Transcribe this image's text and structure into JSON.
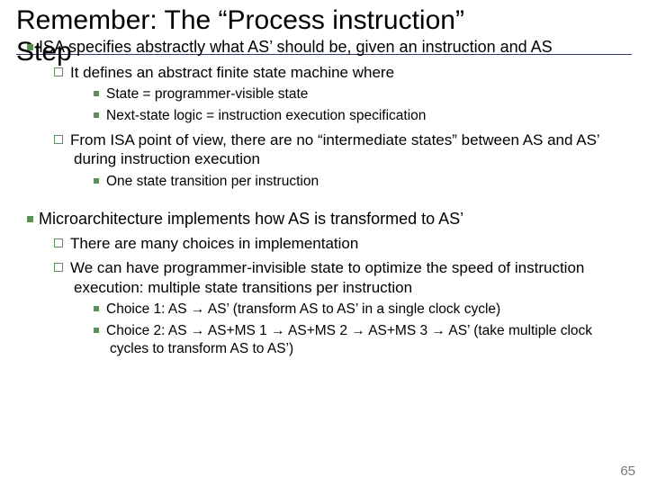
{
  "title_line1": "Remember: The “Process instruction”",
  "title_line2": "Step",
  "b1": "ISA specifies abstractly what AS’ should be, given an instruction and AS",
  "b1_1": "It defines an abstract finite state machine where",
  "b1_1_1": "State = programmer-visible state",
  "b1_1_2": "Next-state logic = instruction execution specification",
  "b1_2": "From ISA point of view, there are no “intermediate states” between AS and AS’ during instruction execution",
  "b1_2_1": "One state transition per instruction",
  "b2": "Microarchitecture implements how AS is transformed to AS’",
  "b2_1": "There are many choices in implementation",
  "b2_2": "We can have programmer-invisible state to optimize the speed of instruction execution: multiple state transitions per instruction",
  "b2_2_1": "Choice 1: AS → AS’ (transform AS to AS’ in a single clock cycle)",
  "b2_2_2": "Choice 2: AS → AS+MS 1 → AS+MS 2 → AS+MS 3 → AS’ (take multiple clock cycles to transform AS to AS’)",
  "page": "65"
}
